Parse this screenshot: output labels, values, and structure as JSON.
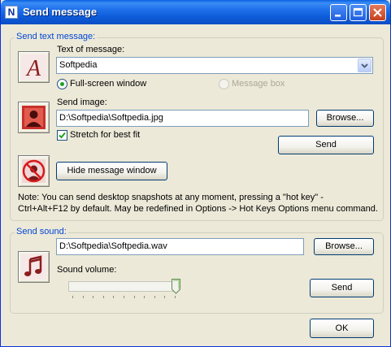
{
  "window": {
    "title": "Send message",
    "app_icon_letter": "N"
  },
  "text_group": {
    "legend": "Send text message:",
    "text_label": "Text of message:",
    "text_value": "Softpedia",
    "radio_fullscreen": "Full-screen window",
    "radio_messagebox": "Message box",
    "fullscreen_selected": true,
    "messagebox_enabled": false,
    "image_label": "Send image:",
    "image_path": "D:\\Softpedia\\Softpedia.jpg",
    "browse_label": "Browse...",
    "stretch_label": "Stretch for best fit",
    "stretch_checked": true,
    "send_label": "Send",
    "hide_label": "Hide message window",
    "note_line1": "Note: You can send desktop snapshots at any moment, pressing a \"hot key\" -",
    "note_line2": "Ctrl+Alt+F12 by default. May be redefined in Options -> Hot Keys Options menu command."
  },
  "sound_group": {
    "legend": "Send sound:",
    "sound_path": "D:\\Softpedia\\Softpedia.wav",
    "browse_label": "Browse...",
    "volume_label": "Sound volume:",
    "volume_level": 1.0,
    "send_label": "Send"
  },
  "footer": {
    "ok_label": "OK"
  },
  "icons": {
    "letter": "letter-a-icon",
    "image": "person-image-icon",
    "hide": "hide-image-icon",
    "sound": "music-note-icon"
  }
}
